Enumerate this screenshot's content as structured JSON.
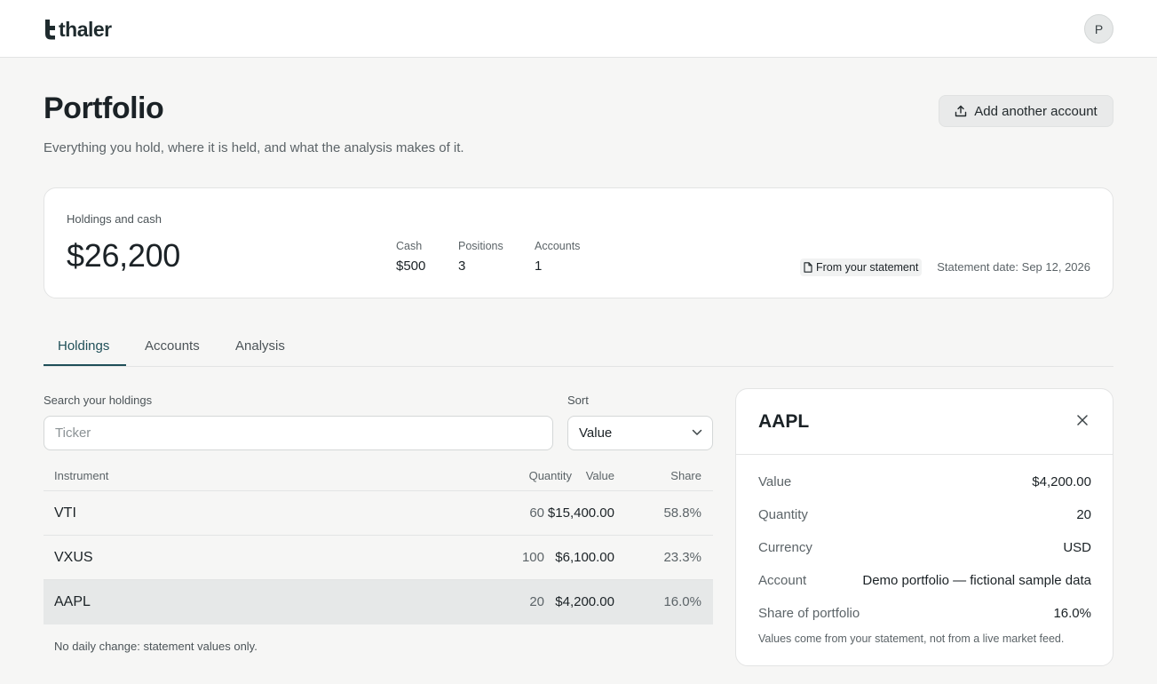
{
  "app": {
    "brand": "thaler",
    "avatar_initial": "P"
  },
  "page": {
    "title": "Portfolio",
    "subtitle": "Everything you hold, where it is held, and what the analysis makes of it.",
    "add_account_label": "Add another account"
  },
  "summary": {
    "label": "Holdings and cash",
    "total": "$26,200",
    "cash_label": "Cash",
    "cash_value": "$500",
    "positions_label": "Positions",
    "positions_value": "3",
    "accounts_label": "Accounts",
    "accounts_value": "1",
    "source_label": "From your statement",
    "statement_date": "Statement date: Sep 12, 2026"
  },
  "tabs": [
    {
      "label": "Holdings",
      "active": true
    },
    {
      "label": "Accounts",
      "active": false
    },
    {
      "label": "Analysis",
      "active": false
    }
  ],
  "filters": {
    "search_label": "Search your holdings",
    "search_placeholder": "Ticker",
    "search_value": "",
    "sort_label": "Sort",
    "sort_value": "Value"
  },
  "table": {
    "headers": {
      "instrument": "Instrument",
      "quantity": "Quantity",
      "value": "Value",
      "share": "Share"
    },
    "rows": [
      {
        "instrument": "VTI",
        "quantity": "60",
        "value": "$15,400.00",
        "share": "58.8%",
        "selected": false
      },
      {
        "instrument": "VXUS",
        "quantity": "100",
        "value": "$6,100.00",
        "share": "23.3%",
        "selected": false
      },
      {
        "instrument": "AAPL",
        "quantity": "20",
        "value": "$4,200.00",
        "share": "16.0%",
        "selected": true
      }
    ],
    "note": "No daily change: statement values only."
  },
  "detail": {
    "title": "AAPL",
    "rows": [
      {
        "label": "Value",
        "value": "$4,200.00"
      },
      {
        "label": "Quantity",
        "value": "20"
      },
      {
        "label": "Currency",
        "value": "USD"
      },
      {
        "label": "Account",
        "value": "Demo portfolio — fictional sample data"
      },
      {
        "label": "Share of portfolio",
        "value": "16.0%"
      }
    ],
    "note": "Values come from your statement, not from a live market feed."
  },
  "icons": {
    "brand_mark": "thaler-logo-icon",
    "add_account": "upload-icon",
    "source": "document-icon",
    "sort": "chevron-down-icon",
    "close": "close-icon"
  },
  "colors": {
    "accent": "#1f4f58",
    "background": "#f6f6f5",
    "selected_row": "#e6e8e8"
  }
}
